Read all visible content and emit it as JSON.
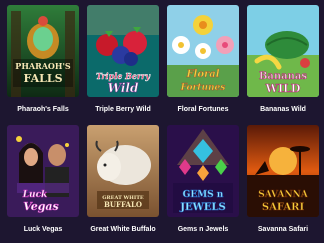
{
  "games": [
    {
      "title": "Pharaoh's Falls",
      "logo_lines": [
        "PHARAOH'S",
        "FALLS"
      ]
    },
    {
      "title": "Triple Berry Wild",
      "logo_lines": [
        "Triple Berry",
        "Wild"
      ]
    },
    {
      "title": "Floral Fortunes",
      "logo_lines": [
        "Floral",
        "Fortunes"
      ]
    },
    {
      "title": "Bananas Wild",
      "logo_lines": [
        "Bananas",
        "WILD"
      ]
    },
    {
      "title": "Luck Vegas",
      "logo_lines": [
        "Luck",
        "Vegas"
      ]
    },
    {
      "title": "Great White Buffalo",
      "logo_lines": [
        "GREAT WHITE",
        "BUFFALO"
      ]
    },
    {
      "title": "Gems n Jewels",
      "logo_lines": [
        "GEMS n",
        "JEWELS"
      ]
    },
    {
      "title": "Savanna Safari",
      "logo_lines": [
        "SAVANNA",
        "SAFARI"
      ]
    }
  ],
  "colors": {
    "background": "#1d1630",
    "title_text": "#ffffff"
  }
}
